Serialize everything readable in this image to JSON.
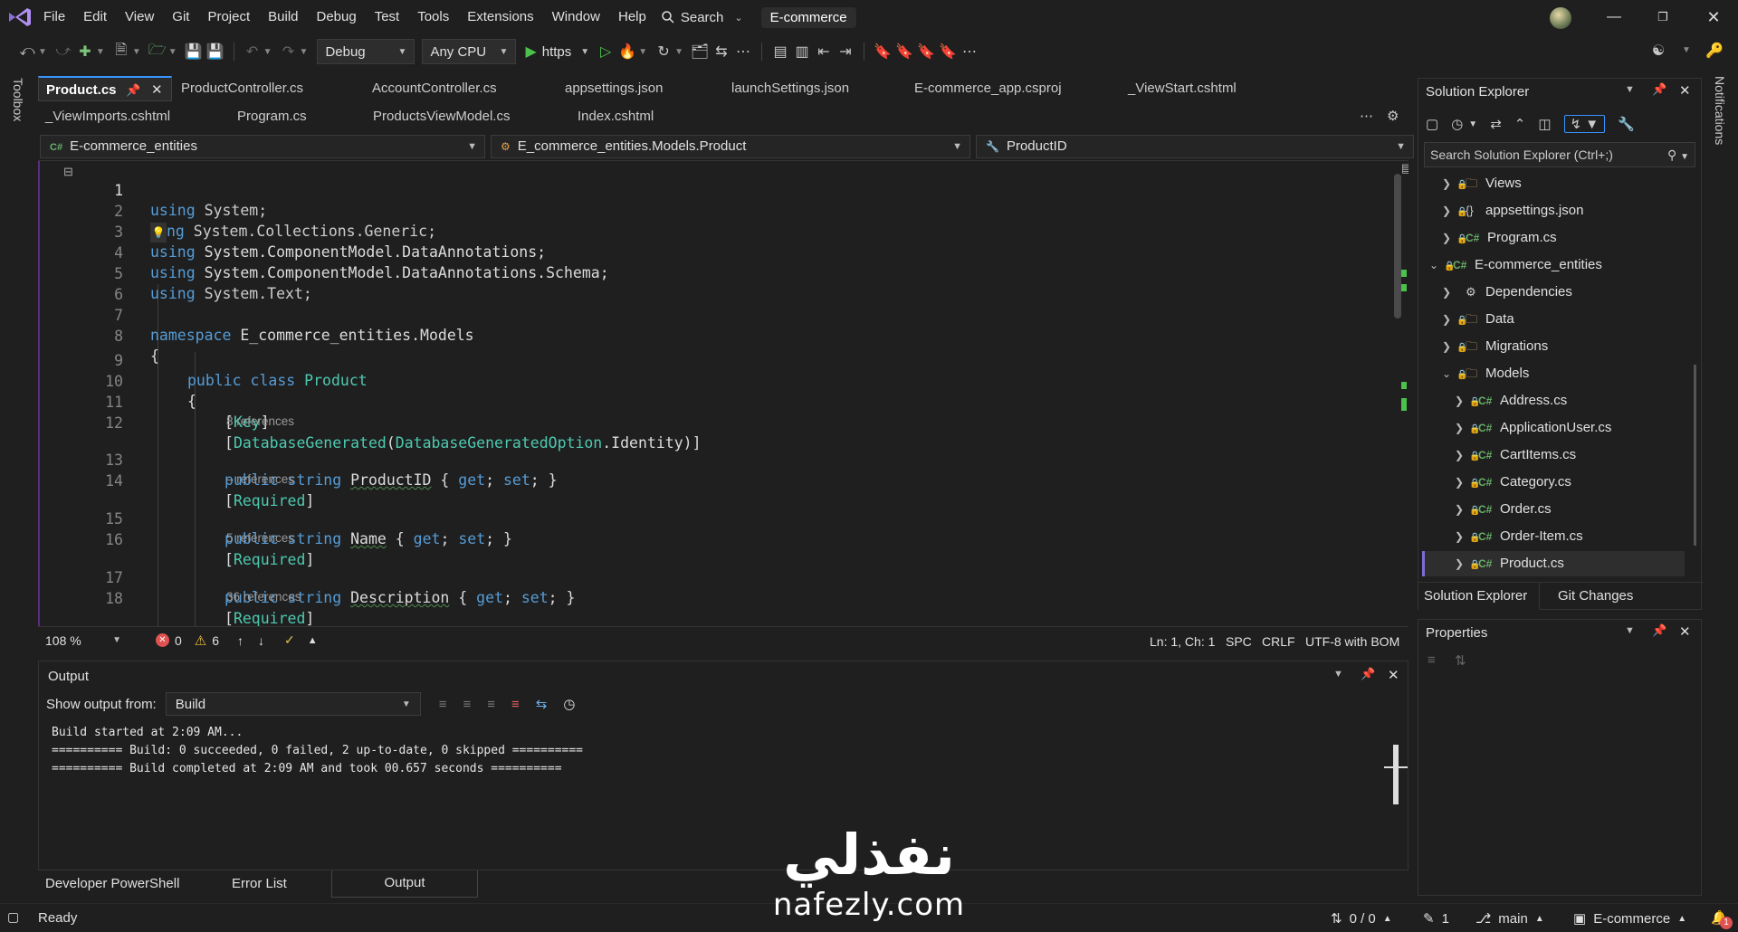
{
  "menu": {
    "items": [
      "File",
      "Edit",
      "View",
      "Git",
      "Project",
      "Build",
      "Debug",
      "Test",
      "Tools",
      "Extensions",
      "Window",
      "Help"
    ],
    "search_label": "Search",
    "solution_title": "E-commerce"
  },
  "toolbar": {
    "config": "Debug",
    "platform": "Any CPU",
    "run_label": "https"
  },
  "side": {
    "toolbox": "Toolbox",
    "notifications": "Notifications"
  },
  "tabs": {
    "row1": [
      "Product.cs",
      "ProductController.cs",
      "AccountController.cs",
      "appsettings.json",
      "launchSettings.json",
      "E-commerce_app.csproj",
      "_ViewStart.cshtml"
    ],
    "row2": [
      "_ViewImports.cshtml",
      "Program.cs",
      "ProductsViewModel.cs",
      "Index.cshtml"
    ]
  },
  "navbar": {
    "project": "E-commerce_entities",
    "type": "E_commerce_entities.Models.Product",
    "member": "ProductID"
  },
  "code": {
    "line_numbers": [
      "1",
      "2",
      "3",
      "4",
      "5",
      "6",
      "7",
      "8",
      "9",
      "10",
      "11",
      "12",
      "13",
      "14",
      "15",
      "16",
      "17",
      "18"
    ],
    "lines": {
      "l1_kw": "using",
      "l1_rest": " System;",
      "l2_kw": "ng",
      "l2_rest": " System.Collections.Generic;",
      "l3_kw": "using",
      "l3_rest": " System.ComponentModel.DataAnnotations;",
      "l4_kw": "using",
      "l4_rest": " System.ComponentModel.DataAnnotations.Schema;",
      "l5_kw": "using",
      "l5_rest": " System.Text;",
      "l7_kw": "namespace",
      "l7_rest": " E_commerce_entities.Models",
      "l8": "{",
      "l9_kw": "public class",
      "l9_type": " Product",
      "l10": "{",
      "l11_attr": "Key",
      "l12_attr": "DatabaseGenerated",
      "l12_arg": "DatabaseGeneratedOption",
      "l12_member": ".Identity",
      "l13_prop": "ProductID",
      "l14_attr": "Required",
      "l15_prop": "Name",
      "l16_attr": "Required",
      "l17_prop": "Description",
      "l18_attr": "Required",
      "public_string": "public string",
      "get_set_open": " { ",
      "get": "get",
      "set": "set",
      "semi": "; ",
      "close": " }"
    },
    "codelens": [
      "8 references",
      "– references",
      "5 references",
      "36 references"
    ]
  },
  "editor_status": {
    "zoom": "108 %",
    "errors": "0",
    "warnings": "6",
    "position": "Ln: 1, Ch: 1",
    "indent": "SPC",
    "line_endings": "CRLF",
    "encoding": "UTF-8 with BOM"
  },
  "output": {
    "title": "Output",
    "show_from_label": "Show output from:",
    "source": "Build",
    "lines": [
      "Build started at 2:09 AM...",
      "========== Build: 0 succeeded, 0 failed, 2 up-to-date, 0 skipped ==========",
      "========== Build completed at 2:09 AM and took 00.657 seconds =========="
    ],
    "tabs": [
      "Developer PowerShell",
      "Error List",
      "Output"
    ]
  },
  "solution_explorer": {
    "title": "Solution Explorer",
    "search_placeholder": "Search Solution Explorer (Ctrl+;)",
    "items": [
      {
        "label": "Views",
        "kind": "folder",
        "level": 1,
        "expanded": false
      },
      {
        "label": "appsettings.json",
        "kind": "json",
        "level": 1,
        "expanded": false
      },
      {
        "label": "Program.cs",
        "kind": "cs",
        "level": 1,
        "expanded": false
      },
      {
        "label": "E-commerce_entities",
        "kind": "project",
        "level": 0,
        "expanded": true
      },
      {
        "label": "Dependencies",
        "kind": "deps",
        "level": 1,
        "expanded": false
      },
      {
        "label": "Data",
        "kind": "folder",
        "level": 1,
        "expanded": false
      },
      {
        "label": "Migrations",
        "kind": "folder",
        "level": 1,
        "expanded": false
      },
      {
        "label": "Models",
        "kind": "folder",
        "level": 1,
        "expanded": true
      },
      {
        "label": "Address.cs",
        "kind": "cs",
        "level": 2,
        "expanded": false
      },
      {
        "label": "ApplicationUser.cs",
        "kind": "cs",
        "level": 2,
        "expanded": false
      },
      {
        "label": "CartItems.cs",
        "kind": "cs",
        "level": 2,
        "expanded": false
      },
      {
        "label": "Category.cs",
        "kind": "cs",
        "level": 2,
        "expanded": false
      },
      {
        "label": "Order.cs",
        "kind": "cs",
        "level": 2,
        "expanded": false
      },
      {
        "label": "Order-Item.cs",
        "kind": "cs",
        "level": 2,
        "expanded": false
      },
      {
        "label": "Product.cs",
        "kind": "cs",
        "level": 2,
        "expanded": false,
        "selected": true
      }
    ],
    "bottom_tabs": [
      "Solution Explorer",
      "Git Changes"
    ]
  },
  "properties": {
    "title": "Properties"
  },
  "statusbar": {
    "ready": "Ready",
    "sync": "0 / 0",
    "edits": "1",
    "branch": "main",
    "repo": "E-commerce",
    "notif_count": "1"
  },
  "watermark": {
    "arabic": "نفذلي",
    "url": "nafezly.com"
  },
  "colors": {
    "keyword": "#569cd6",
    "type": "#4ec9b0",
    "accent": "#3794ff",
    "codelens": "#999999",
    "selection_bar": "#7f6bd8"
  }
}
